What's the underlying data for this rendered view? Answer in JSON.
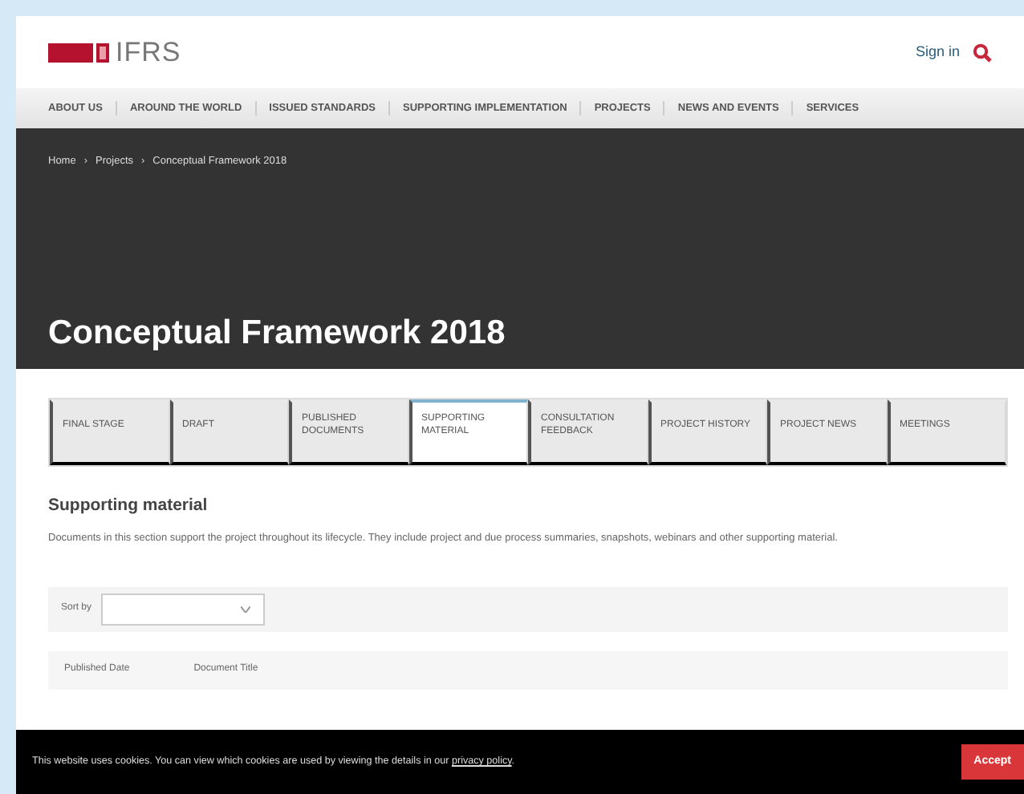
{
  "header": {
    "logo_text": "IFRS",
    "sign_in": "Sign in"
  },
  "nav": [
    "ABOUT US",
    "AROUND THE WORLD",
    "ISSUED STANDARDS",
    "SUPPORTING IMPLEMENTATION",
    "PROJECTS",
    "NEWS AND EVENTS",
    "SERVICES"
  ],
  "breadcrumb": {
    "separator": "›",
    "items": [
      "Home",
      "Projects",
      "Conceptual Framework 2018"
    ]
  },
  "page_title": "Conceptual Framework 2018",
  "tabs": [
    {
      "label": "FINAL STAGE",
      "selected": false
    },
    {
      "label": "DRAFT",
      "selected": false
    },
    {
      "label": "PUBLISHED DOCUMENTS",
      "selected": false
    },
    {
      "label": "SUPPORTING MATERIAL",
      "selected": true
    },
    {
      "label": "CONSULTATION FEEDBACK",
      "selected": false
    },
    {
      "label": "PROJECT HISTORY",
      "selected": false
    },
    {
      "label": "PROJECT NEWS",
      "selected": false
    },
    {
      "label": "MEETINGS",
      "selected": false
    }
  ],
  "section": {
    "heading": "Supporting material",
    "description": "Documents in this section support the project throughout its lifecycle. They include project and due process summaries, snapshots, webinars and other supporting material."
  },
  "sort": {
    "label": "Sort by"
  },
  "table": {
    "columns": [
      "Published Date",
      "Document Title"
    ]
  },
  "cookie_bar": {
    "text": "This website uses cookies. You can view which cookies are used by viewing the details in our ",
    "link": "privacy policy",
    "end": ".",
    "button": "Accept"
  }
}
